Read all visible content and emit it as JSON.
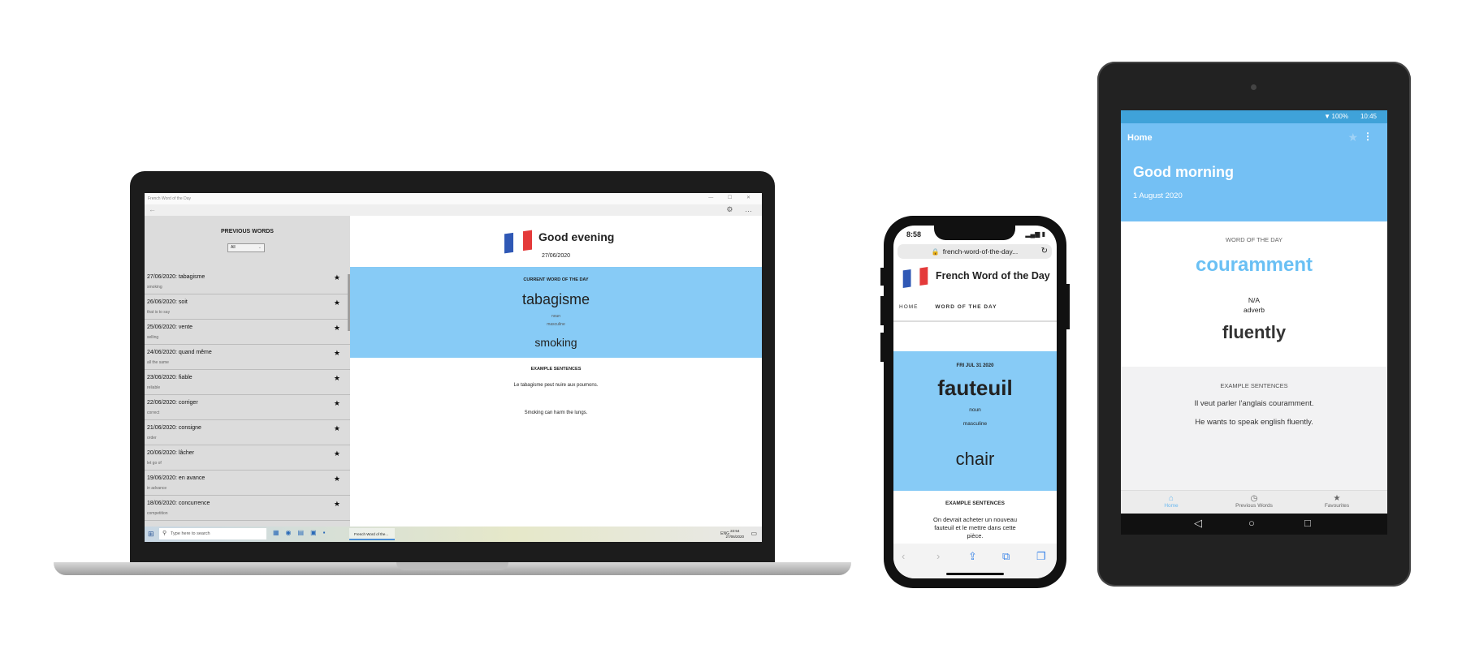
{
  "laptop": {
    "window_title": "French Word of the Day",
    "window_controls": "— ☐ ✕",
    "back_glyph": "←",
    "toolbar_glyphs": "⚙ …",
    "sidebar": {
      "title": "PREVIOUS WORDS",
      "filter_value": "All",
      "items": [
        {
          "word": "27/06/2020: tabagisme",
          "translation": "smoking"
        },
        {
          "word": "26/06/2020: soit",
          "translation": "that is to say"
        },
        {
          "word": "25/06/2020: vente",
          "translation": "selling"
        },
        {
          "word": "24/06/2020: quand même",
          "translation": "all the same"
        },
        {
          "word": "23/06/2020: fiable",
          "translation": "reliable"
        },
        {
          "word": "22/06/2020: corriger",
          "translation": "correct"
        },
        {
          "word": "21/06/2020: consigne",
          "translation": "order"
        },
        {
          "word": "20/06/2020: lâcher",
          "translation": "let go of"
        },
        {
          "word": "19/06/2020: en avance",
          "translation": "in advance"
        },
        {
          "word": "18/06/2020: concurrence",
          "translation": "competition"
        }
      ]
    },
    "main": {
      "greeting": "Good evening",
      "date": "27/06/2020",
      "current_label": "CURRENT WORD OF THE DAY",
      "word": "tabagisme",
      "pos": "noun",
      "gender": "masculine",
      "translation": "smoking",
      "examples_label": "EXAMPLE SENTENCES",
      "sentence_fr": "Le tabagisme peut nuire aux poumons.",
      "sentence_en": "Smoking can harm the lungs."
    },
    "taskbar": {
      "search_placeholder": "Type here to search",
      "app_label": "French Word of the...",
      "lang": "ENG",
      "time": "22:54",
      "date": "27/06/2020"
    }
  },
  "phone": {
    "time": "8:58",
    "url": "french-word-of-the-day...",
    "app_title": "French Word of the Day",
    "nav_home": "HOME",
    "nav_wotd": "WORD OF THE DAY",
    "date": "FRI JUL 31 2020",
    "word": "fauteuil",
    "pos": "noun",
    "gender": "masculine",
    "translation": "chair",
    "examples_label": "EXAMPLE SENTENCES",
    "sentence": "On devrait acheter un nouveau fauteuil et le mettre dans cette pièce."
  },
  "tablet": {
    "battery": "100%",
    "time": "10:45",
    "header_title": "Home",
    "greeting": "Good morning",
    "date": "1 August 2020",
    "wotd_label": "WORD OF THE DAY",
    "word": "couramment",
    "gender": "N/A",
    "pos": "adverb",
    "translation": "fluently",
    "examples_label": "EXAMPLE SENTENCES",
    "sentence_fr": "Il veut parler l'anglais couramment.",
    "sentence_en": "He wants to speak english fluently.",
    "tabs": [
      "Home",
      "Previous Words",
      "Favourites"
    ]
  },
  "colors": {
    "accent_blue": "#87cbf6",
    "tablet_header": "#74c0f4",
    "flag_blue": "#2f58b5",
    "flag_red": "#e43a3a"
  }
}
